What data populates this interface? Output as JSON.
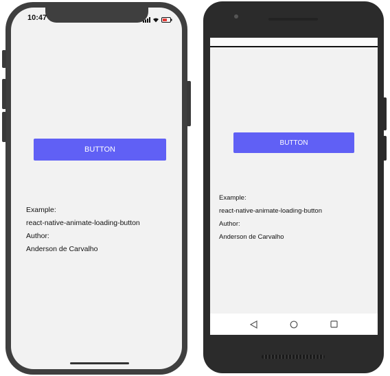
{
  "accent_color": "#6060f5",
  "ios": {
    "status_bar": {
      "time": "10:47"
    },
    "button_label": "BUTTON",
    "info": {
      "example_label": "Example:",
      "example_value": "react-native-animate-loading-button",
      "author_label": "Author:",
      "author_value": "Anderson de Carvalho"
    }
  },
  "android": {
    "button_label": "BUTTON",
    "info": {
      "example_label": "Example:",
      "example_value": "react-native-animate-loading-button",
      "author_label": "Author:",
      "author_value": "Anderson de Carvalho"
    },
    "nav_icons": [
      "back-triangle-icon",
      "home-circle-icon",
      "recents-square-icon"
    ]
  }
}
